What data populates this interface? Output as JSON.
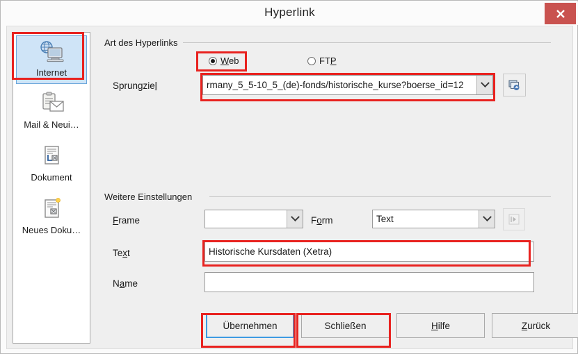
{
  "window": {
    "title": "Hyperlink",
    "close_label": "✕"
  },
  "sidebar": {
    "items": [
      {
        "label": "Internet",
        "icon": "globe-monitor-icon",
        "selected": true
      },
      {
        "label": "Mail & Neui…",
        "icon": "clipboard-envelope-icon",
        "selected": false
      },
      {
        "label": "Dokument",
        "icon": "document-target-icon",
        "selected": false
      },
      {
        "label": "Neues Doku…",
        "icon": "new-document-icon",
        "selected": false
      }
    ]
  },
  "hyperlink_type": {
    "group_label": "Art des Hyperlinks",
    "radios": [
      {
        "label": "Web",
        "accesskey": "W",
        "checked": true
      },
      {
        "label": "FTP",
        "accesskey": "P",
        "checked": false
      }
    ],
    "target": {
      "label": "Sprungziel",
      "accesskey": "l",
      "value": "rmany_5_5-10_5_(de)-fonds/historische_kurse?boerse_id=12",
      "browse_icon": "open-folder-icon"
    }
  },
  "further_settings": {
    "group_label": "Weitere Einstellungen",
    "frame": {
      "label": "Frame",
      "accesskey": "F",
      "value": ""
    },
    "form": {
      "label": "Form",
      "accesskey": "o",
      "value": "Text"
    },
    "events_button_icon": "events-arrow-icon",
    "text": {
      "label": "Text",
      "accesskey": "x",
      "value": "Historische Kursdaten (Xetra)"
    },
    "name": {
      "label": "Name",
      "accesskey": "a",
      "value": ""
    }
  },
  "buttons": [
    {
      "label": "Übernehmen",
      "name": "apply-button",
      "accesskey": "",
      "focused": true
    },
    {
      "label": "Schließen",
      "name": "close-button",
      "accesskey": "",
      "focused": false
    },
    {
      "label": "Hilfe",
      "name": "help-button",
      "accesskey": "H",
      "focused": false
    },
    {
      "label": "Zurück",
      "name": "back-button",
      "accesskey": "Z",
      "focused": false
    }
  ],
  "colors": {
    "highlight": "#e8221f",
    "close_bg": "#c9524f",
    "selection_bg": "#cfe4f7",
    "focus_border": "#3d9ae2"
  }
}
